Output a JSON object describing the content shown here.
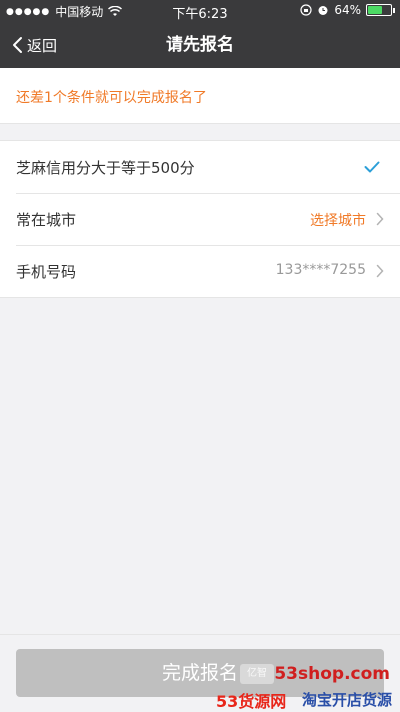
{
  "status_bar": {
    "signal_dots": "●●●●●",
    "carrier": "中国移动",
    "time": "下午6:23",
    "battery_percent": "64%",
    "battery_level": 0.64,
    "icons": [
      "wifi-icon",
      "lock-rotation-icon",
      "alarm-icon",
      "battery-icon"
    ]
  },
  "nav": {
    "back_label": "返回",
    "title": "请先报名"
  },
  "notice": {
    "text": "还差1个条件就可以完成报名了",
    "color": "#f07a28"
  },
  "conditions": [
    {
      "label": "芝麻信用分大于等于500分",
      "value": "",
      "status": "met"
    },
    {
      "label": "常在城市",
      "value": "选择城市",
      "value_color": "#f07a28"
    },
    {
      "label": "手机号码",
      "value": "133****7255",
      "value_color": "#999999"
    }
  ],
  "submit": {
    "label": "完成报名",
    "enabled": false
  },
  "watermark": {
    "logo_text": "亿智",
    "site": "53shop.com",
    "brand": "53货源网",
    "tagline": "淘宝开店货源"
  },
  "colors": {
    "header_bg": "#3a3a3c",
    "accent": "#f07a28",
    "check": "#2c9fd8",
    "page_bg": "#f2f2f4"
  }
}
